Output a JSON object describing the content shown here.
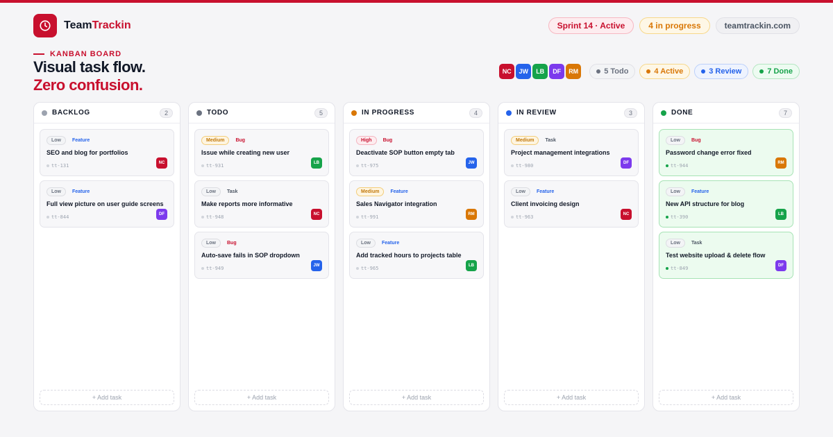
{
  "brand": {
    "name_part1": "Team",
    "name_part2": "Trackin"
  },
  "top_pills": [
    {
      "label": "Sprint 14 · Active",
      "tone": "red"
    },
    {
      "label": "4 in progress",
      "tone": "orange"
    },
    {
      "label": "teamtrackin.com",
      "tone": "grey"
    }
  ],
  "hero": {
    "kicker": "KANBAN BOARD",
    "line1": "Visual task flow.",
    "line2": "Zero confusion."
  },
  "team": [
    {
      "initials": "NC",
      "color": "#c8102e"
    },
    {
      "initials": "JW",
      "color": "#2563eb"
    },
    {
      "initials": "LB",
      "color": "#16a34a"
    },
    {
      "initials": "DF",
      "color": "#7c3aed"
    },
    {
      "initials": "RM",
      "color": "#d97706"
    }
  ],
  "stats": [
    {
      "label": "5 Todo",
      "color": "#6b7280",
      "bg": "#f3f4f6",
      "border": "#e0e0e6"
    },
    {
      "label": "4 Active",
      "color": "#d97706",
      "bg": "#fef7e6",
      "border": "#f7d88a"
    },
    {
      "label": "3 Review",
      "color": "#2563eb",
      "bg": "#eef3fe",
      "border": "#bcd0fa"
    },
    {
      "label": "7 Done",
      "color": "#16a34a",
      "bg": "#edfbf1",
      "border": "#b3e6c1"
    }
  ],
  "add_label": "+ Add task",
  "columns": [
    {
      "title": "BACKLOG",
      "count": "2",
      "color": "#9ca3af",
      "done": false,
      "cards": [
        {
          "priority": "Low",
          "type": "Feature",
          "title": "SEO and blog for portfolios",
          "id": "tt-131",
          "assignee": "NC",
          "av_color": "#c8102e"
        },
        {
          "priority": "Low",
          "type": "Feature",
          "title": "Full view picture on user guide screens",
          "id": "tt-844",
          "assignee": "DF",
          "av_color": "#7c3aed"
        }
      ]
    },
    {
      "title": "TODO",
      "count": "5",
      "color": "#6b7280",
      "done": false,
      "cards": [
        {
          "priority": "Medium",
          "type": "Bug",
          "title": "Issue while creating new user",
          "id": "tt-931",
          "assignee": "LB",
          "av_color": "#16a34a"
        },
        {
          "priority": "Low",
          "type": "Task",
          "title": "Make reports more informative",
          "id": "tt-948",
          "assignee": "NC",
          "av_color": "#c8102e"
        },
        {
          "priority": "Low",
          "type": "Bug",
          "title": "Auto-save fails in SOP dropdown",
          "id": "tt-949",
          "assignee": "JW",
          "av_color": "#2563eb"
        }
      ]
    },
    {
      "title": "IN PROGRESS",
      "count": "4",
      "color": "#d97706",
      "done": false,
      "cards": [
        {
          "priority": "High",
          "type": "Bug",
          "title": "Deactivate SOP button empty tab",
          "id": "tt-975",
          "assignee": "JW",
          "av_color": "#2563eb"
        },
        {
          "priority": "Medium",
          "type": "Feature",
          "title": "Sales Navigator integration",
          "id": "tt-991",
          "assignee": "RM",
          "av_color": "#d97706"
        },
        {
          "priority": "Low",
          "type": "Feature",
          "title": "Add tracked hours to projects table",
          "id": "tt-965",
          "assignee": "LB",
          "av_color": "#16a34a"
        }
      ]
    },
    {
      "title": "IN REVIEW",
      "count": "3",
      "color": "#2563eb",
      "done": false,
      "cards": [
        {
          "priority": "Medium",
          "type": "Task",
          "title": "Project management integrations",
          "id": "tt-980",
          "assignee": "DF",
          "av_color": "#7c3aed"
        },
        {
          "priority": "Low",
          "type": "Feature",
          "title": "Client invoicing design",
          "id": "tt-963",
          "assignee": "NC",
          "av_color": "#c8102e"
        }
      ]
    },
    {
      "title": "DONE",
      "count": "7",
      "color": "#16a34a",
      "done": true,
      "cards": [
        {
          "priority": "Low",
          "type": "Bug",
          "title": "Password change error fixed",
          "id": "tt-944",
          "assignee": "RM",
          "av_color": "#d97706"
        },
        {
          "priority": "Low",
          "type": "Feature",
          "title": "New API structure for blog",
          "id": "tt-390",
          "assignee": "LB",
          "av_color": "#16a34a"
        },
        {
          "priority": "Low",
          "type": "Task",
          "title": "Test website upload & delete flow",
          "id": "tt-849",
          "assignee": "DF",
          "av_color": "#7c3aed"
        }
      ]
    }
  ]
}
